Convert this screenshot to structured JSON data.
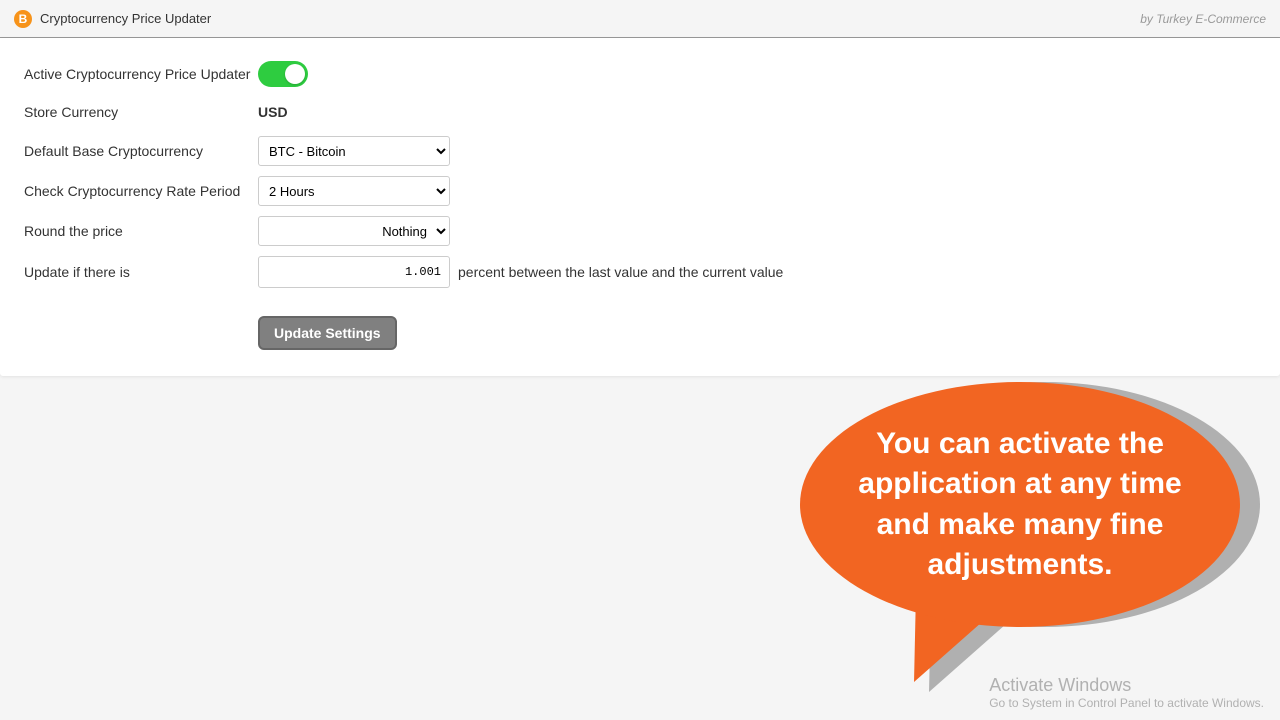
{
  "header": {
    "title": "Cryptocurrency Price Updater",
    "byline": "by Turkey E-Commerce"
  },
  "form": {
    "active_label": "Active Cryptocurrency Price Updater",
    "store_currency_label": "Store Currency",
    "store_currency_value": "USD",
    "base_crypto_label": "Default Base Cryptocurrency",
    "base_crypto_value": "BTC - Bitcoin",
    "rate_period_label": "Check Cryptocurrency Rate Period",
    "rate_period_value": "2 Hours",
    "round_label": "Round the price",
    "round_value": "Nothing",
    "update_if_label": "Update if there is",
    "update_if_value": "1.001",
    "update_if_suffix": "percent between the last value and the current value",
    "update_button": "Update Settings"
  },
  "bubble": {
    "text": "You can activate the application at any time and make many fine adjustments."
  },
  "watermark": {
    "line1": "Activate Windows",
    "line2": "Go to System in Control Panel to activate Windows."
  },
  "icons": {
    "bitcoin_glyph": "B"
  }
}
